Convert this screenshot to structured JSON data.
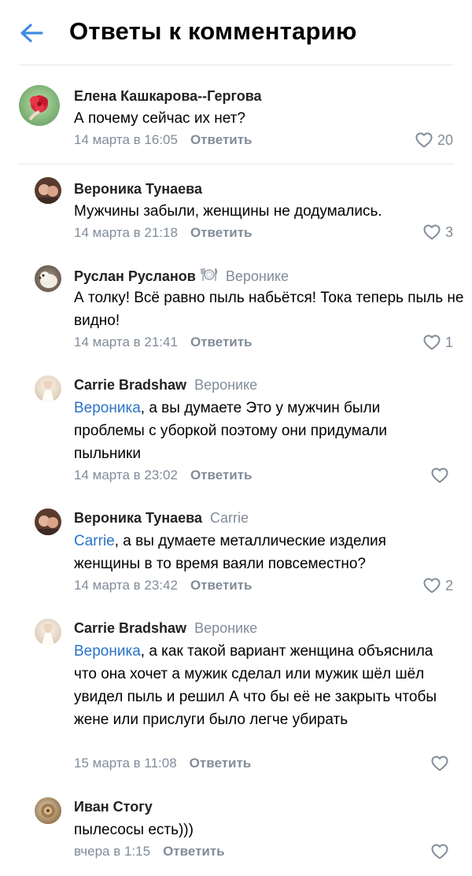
{
  "header": {
    "title": "Ответы к комментарию",
    "back_icon": "arrow-left-icon",
    "accent": "#3f8ae0"
  },
  "colors": {
    "mention": "#2a73c7",
    "secondary": "#818c99",
    "divider": "#e7e8ec"
  },
  "root_comment": {
    "author": "Елена Кашкарова--Гергова",
    "text": "А почему сейчас их нет?",
    "date": "14 марта в 16:05",
    "reply_label": "Ответить",
    "likes": "20"
  },
  "replies": [
    {
      "author": "Вероника Тунаева",
      "text": "Мужчины забыли, женщины не додумались.",
      "date": "14 марта в 21:18",
      "reply_label": "Ответить",
      "likes": "3"
    },
    {
      "author": "Руслан Русланов",
      "badge_icon": "plate-icon",
      "reply_to": "Веронике",
      "text": "А толку! Всё равно пыль набьётся! Тока теперь пыль не видно!",
      "date": "14 марта в 21:41",
      "reply_label": "Ответить",
      "likes": "1"
    },
    {
      "author": "Carrie Bradshaw",
      "reply_to": "Веронике",
      "mention": "Вероника",
      "text": ", а вы думаете Это у мужчин были проблемы с уборкой поэтому они придумали пыльники",
      "date": "14 марта в 23:02",
      "reply_label": "Ответить",
      "likes": ""
    },
    {
      "author": "Вероника Тунаева",
      "reply_to": "Carrie",
      "mention": "Carrie",
      "text": ", а вы думаете металлические изделия женщины в то время ваяли повсеместно?",
      "date": "14 марта в 23:42",
      "reply_label": "Ответить",
      "likes": "2"
    },
    {
      "author": "Carrie Bradshaw",
      "reply_to": "Веронике",
      "mention": "Вероника",
      "text": ", а как такой вариант женщина объяснила что она хочет а мужик сделал или мужик шёл шёл увидел пыль и решил А что бы её не закрыть чтобы жене или прислуги было легче убирать",
      "date": "15 марта в 11:08",
      "reply_label": "Ответить",
      "likes": ""
    },
    {
      "author": "Иван Стогу",
      "text": "пылесосы есть)))",
      "date": "вчера в 1:15",
      "reply_label": "Ответить",
      "likes": ""
    }
  ]
}
